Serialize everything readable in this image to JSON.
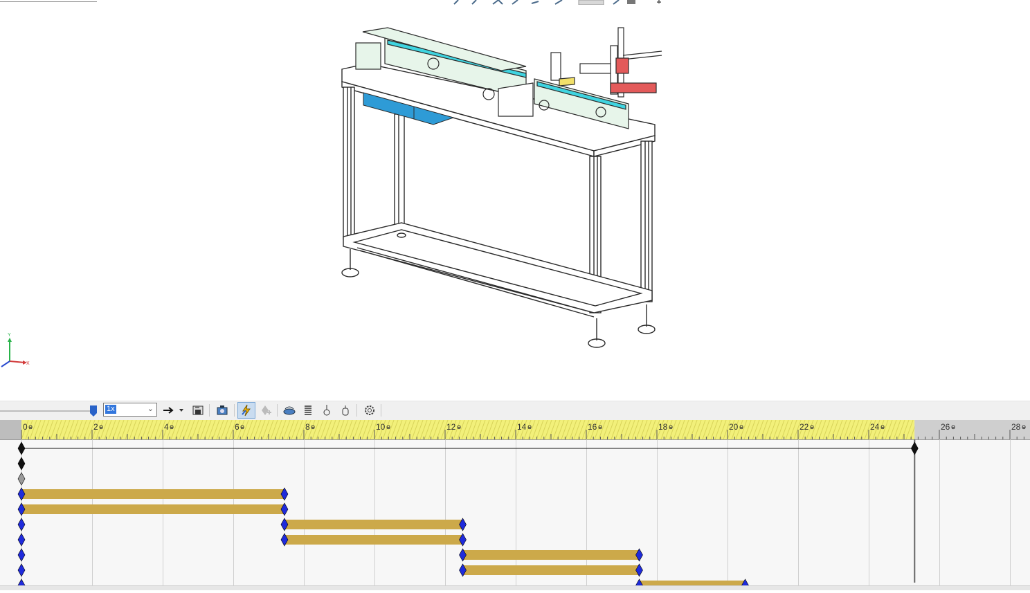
{
  "viewport": {
    "accent_cyan": "#3fd4e0",
    "accent_blue": "#2e9bd6",
    "accent_red": "#e35a5a",
    "frame_color": "#2a2a2a",
    "panel_fill": "#e7f5ea"
  },
  "triad": {
    "y_label": "Y",
    "x_label": "X"
  },
  "anim_toolbar": {
    "speed_value": "1x",
    "icons": [
      "timeline-slider-thumb",
      "speed-dropdown",
      "playback-mode-icon",
      "save-animation-icon",
      "animation-wizard-icon",
      "autokey-icon",
      "add-key-icon",
      "motor-icon",
      "spring-icon",
      "contact-icon",
      "gravity-icon",
      "study-properties-icon"
    ]
  },
  "timeline": {
    "ruler_labels": [
      "0",
      "2",
      "4",
      "6",
      "8",
      "10",
      "12",
      "14",
      "16",
      "18",
      "20",
      "22",
      "24",
      "26",
      "28"
    ],
    "time_unit": "sec",
    "end_time": 25.3,
    "playhead": 25.3,
    "colors": {
      "ruler_active": "#f2f07a",
      "ruler_inactive": "#cfcfcf",
      "bar": "#cca94a",
      "key_blue": "#1f2bdb",
      "key_black": "#111111",
      "key_gray": "#9a9a9a"
    },
    "rows": [
      {
        "kind": "span",
        "start": 0,
        "end": 25.3,
        "key_color": "black"
      },
      {
        "kind": "key",
        "at": 0,
        "key_color": "black"
      },
      {
        "kind": "key",
        "at": 0,
        "key_color": "gray"
      },
      {
        "kind": "bar",
        "start": 0,
        "end": 7.45,
        "key_color": "blue"
      },
      {
        "kind": "bar",
        "start": 0,
        "end": 7.45,
        "key_color": "blue"
      },
      {
        "kind": "bar",
        "start": 7.45,
        "end": 12.5,
        "key_color": "blue",
        "lead_key": 0
      },
      {
        "kind": "bar",
        "start": 7.45,
        "end": 12.5,
        "key_color": "blue",
        "lead_key": 0
      },
      {
        "kind": "bar",
        "start": 12.5,
        "end": 17.5,
        "key_color": "blue",
        "lead_key": 0
      },
      {
        "kind": "bar",
        "start": 12.5,
        "end": 17.5,
        "key_color": "blue",
        "lead_key": 0
      },
      {
        "kind": "bar",
        "start": 17.5,
        "end": 20.5,
        "key_color": "blue",
        "lead_key": 0
      }
    ]
  }
}
